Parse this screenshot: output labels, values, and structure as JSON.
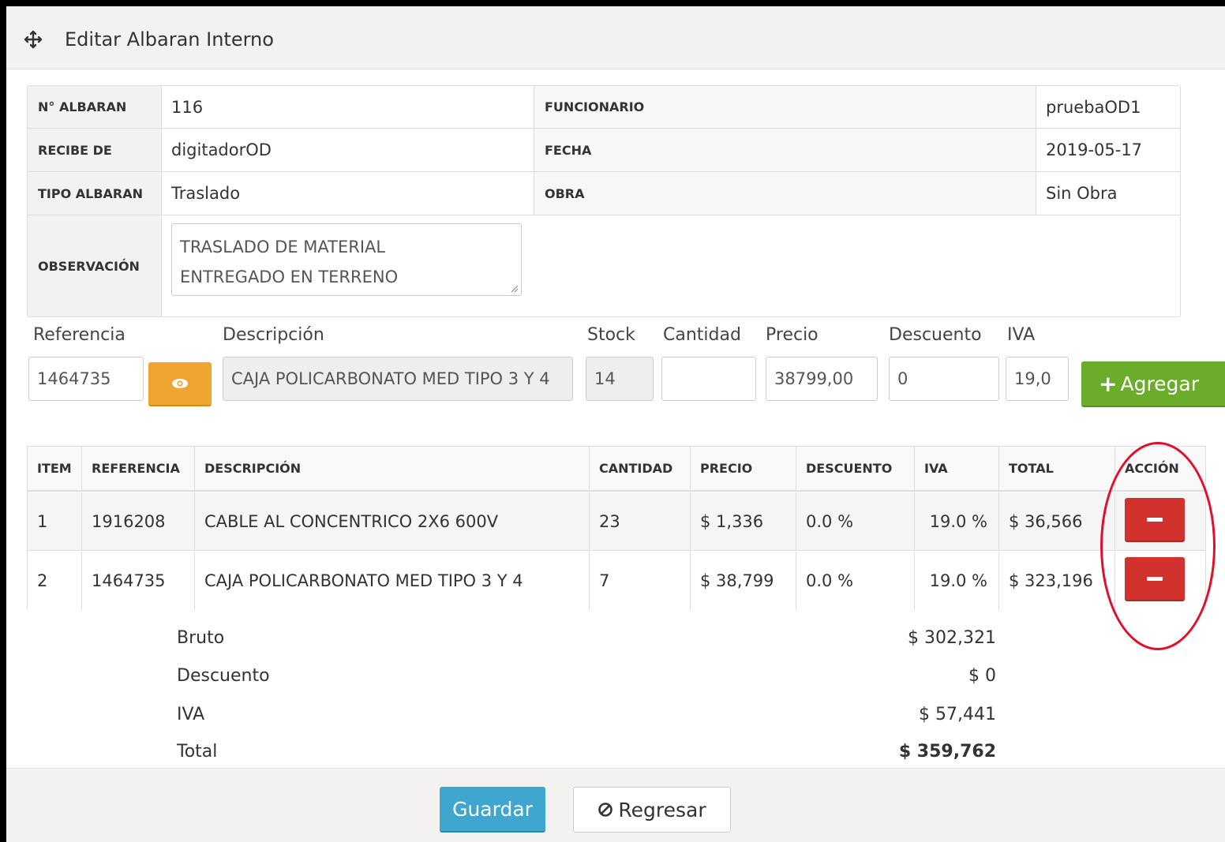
{
  "header": {
    "title": "Editar Albaran Interno",
    "icon": "move-icon"
  },
  "info": {
    "no_albaran_label": "N° ALBARAN",
    "no_albaran": "116",
    "funcionario_label": "FUNCIONARIO",
    "funcionario": "pruebaOD1",
    "recibe_de_label": "RECIBE DE",
    "recibe_de": "digitadorOD",
    "fecha_label": "FECHA",
    "fecha": "2019-05-17",
    "tipo_label": "TIPO ALBARAN",
    "tipo": "Traslado",
    "obra_label": "OBRA",
    "obra": "Sin Obra",
    "observacion_label": "OBSERVACIÓN",
    "observacion_line1": "TRASLADO DE MATERIAL",
    "observacion_line2": "ENTREGADO EN TERRENO"
  },
  "form": {
    "referencia_label": "Referencia",
    "referencia": "1464735",
    "descripcion_label": "Descripción",
    "descripcion": "CAJA POLICARBONATO MED TIPO 3 Y 4",
    "stock_label": "Stock",
    "stock": "14",
    "cantidad_label": "Cantidad",
    "cantidad": "",
    "precio_label": "Precio",
    "precio": "38799,00",
    "descuento_label": "Descuento",
    "descuento": "0",
    "iva_label": "IVA",
    "iva": "19,0",
    "add_label": "Agregar"
  },
  "table": {
    "headers": [
      "ITEM",
      "REFERENCIA",
      "DESCRIPCIÓN",
      "CANTIDAD",
      "PRECIO",
      "DESCUENTO",
      "IVA",
      "TOTAL",
      "ACCIÓN"
    ],
    "rows": [
      {
        "item": "1",
        "referencia": "1916208",
        "descripcion": "CABLE AL CONCENTRICO 2X6 600V",
        "cantidad": "23",
        "precio": "$ 1,336",
        "descuento": "0.0 %",
        "iva": "19.0 %",
        "total": "$ 36,566"
      },
      {
        "item": "2",
        "referencia": "1464735",
        "descripcion": "CAJA POLICARBONATO MED TIPO 3 Y 4",
        "cantidad": "7",
        "precio": "$ 38,799",
        "descuento": "0.0 %",
        "iva": "19.0 %",
        "total": "$ 323,196"
      }
    ]
  },
  "totals": {
    "bruto_label": "Bruto",
    "bruto": "$ 302,321",
    "descuento_label": "Descuento",
    "descuento": "$ 0",
    "iva_label": "IVA",
    "iva": "$ 57,441",
    "total_label": "Total",
    "total": "$ 359,762"
  },
  "footer": {
    "save_label": "Guardar",
    "back_label": "Regresar"
  },
  "colors": {
    "add": "#6aad2a",
    "eye": "#f0a530",
    "remove": "#d2322d",
    "save": "#3fa6cf",
    "highlight": "#e0102a"
  }
}
